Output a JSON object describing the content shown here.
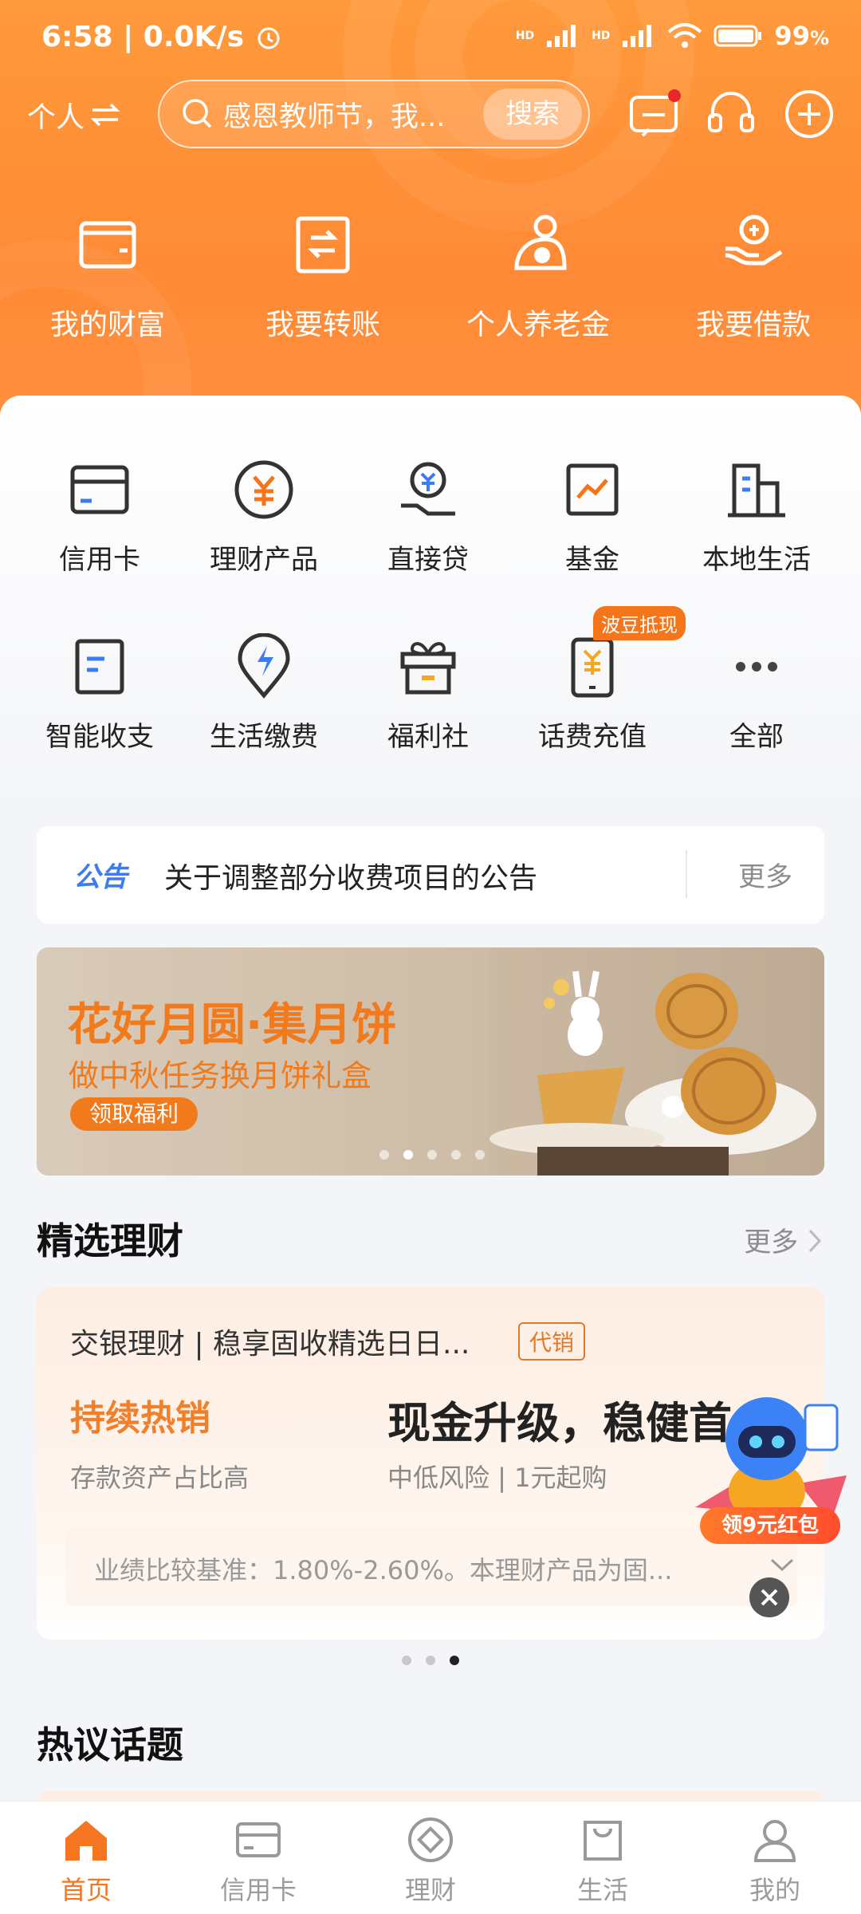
{
  "status": {
    "time": "6:58",
    "speed": "0.0K/s",
    "battery": "99",
    "battery_unit": "%",
    "hd1": "HD",
    "hd2": "HD"
  },
  "topbar": {
    "personal_label": "个人",
    "search_placeholder": "感恩教师节，我...",
    "search_button": "搜索"
  },
  "quick_actions": [
    {
      "label": "我的财富",
      "icon": "wallet-icon"
    },
    {
      "label": "我要转账",
      "icon": "transfer-icon"
    },
    {
      "label": "个人养老金",
      "icon": "pension-icon"
    },
    {
      "label": "我要借款",
      "icon": "loan-hand-icon"
    }
  ],
  "services_row1": [
    {
      "label": "信用卡",
      "icon": "credit-card-icon"
    },
    {
      "label": "理财产品",
      "icon": "yuan-coin-icon"
    },
    {
      "label": "直接贷",
      "icon": "direct-loan-icon"
    },
    {
      "label": "基金",
      "icon": "fund-chart-icon"
    },
    {
      "label": "本地生活",
      "icon": "building-icon"
    }
  ],
  "services_row2": [
    {
      "label": "智能收支",
      "icon": "document-icon"
    },
    {
      "label": "生活缴费",
      "icon": "bolt-pin-icon"
    },
    {
      "label": "福利社",
      "icon": "gift-icon"
    },
    {
      "label": "话费充值",
      "icon": "phone-yuan-icon",
      "badge": "波豆抵现"
    },
    {
      "label": "全部",
      "icon": "more-dots-icon"
    }
  ],
  "notice": {
    "tag": "公告",
    "text": "关于调整部分收费项目的公告",
    "more": "更多"
  },
  "banner": {
    "title": "花好月圆·集月饼",
    "subtitle": "做中秋任务换月饼礼盒",
    "button": "领取福利"
  },
  "finance": {
    "title": "精选理财",
    "more": "更多",
    "card": {
      "name": "交银理财 | 稳享固收精选日日...",
      "tag": "代销",
      "hot": "持续热销",
      "hot_sub": "存款资产占比高",
      "headline": "现金升级，稳健首",
      "risk": "中低风险 | 1元起购",
      "benchmark": "业绩比较基准：1.80%-2.60%。本理财产品为固..."
    }
  },
  "float_promo": {
    "label": "领9元红包"
  },
  "hot_topics": {
    "title": "热议话题"
  },
  "tabs": [
    {
      "label": "首页",
      "icon": "home-icon",
      "active": true
    },
    {
      "label": "信用卡",
      "icon": "credit-card-tab-icon"
    },
    {
      "label": "理财",
      "icon": "finance-icon"
    },
    {
      "label": "生活",
      "icon": "shopping-bag-icon"
    },
    {
      "label": "我的",
      "icon": "user-icon"
    }
  ],
  "colors": {
    "brand_orange": "#ff8a35",
    "accent_orange": "#f57521",
    "notice_blue": "#3b7cf2"
  }
}
